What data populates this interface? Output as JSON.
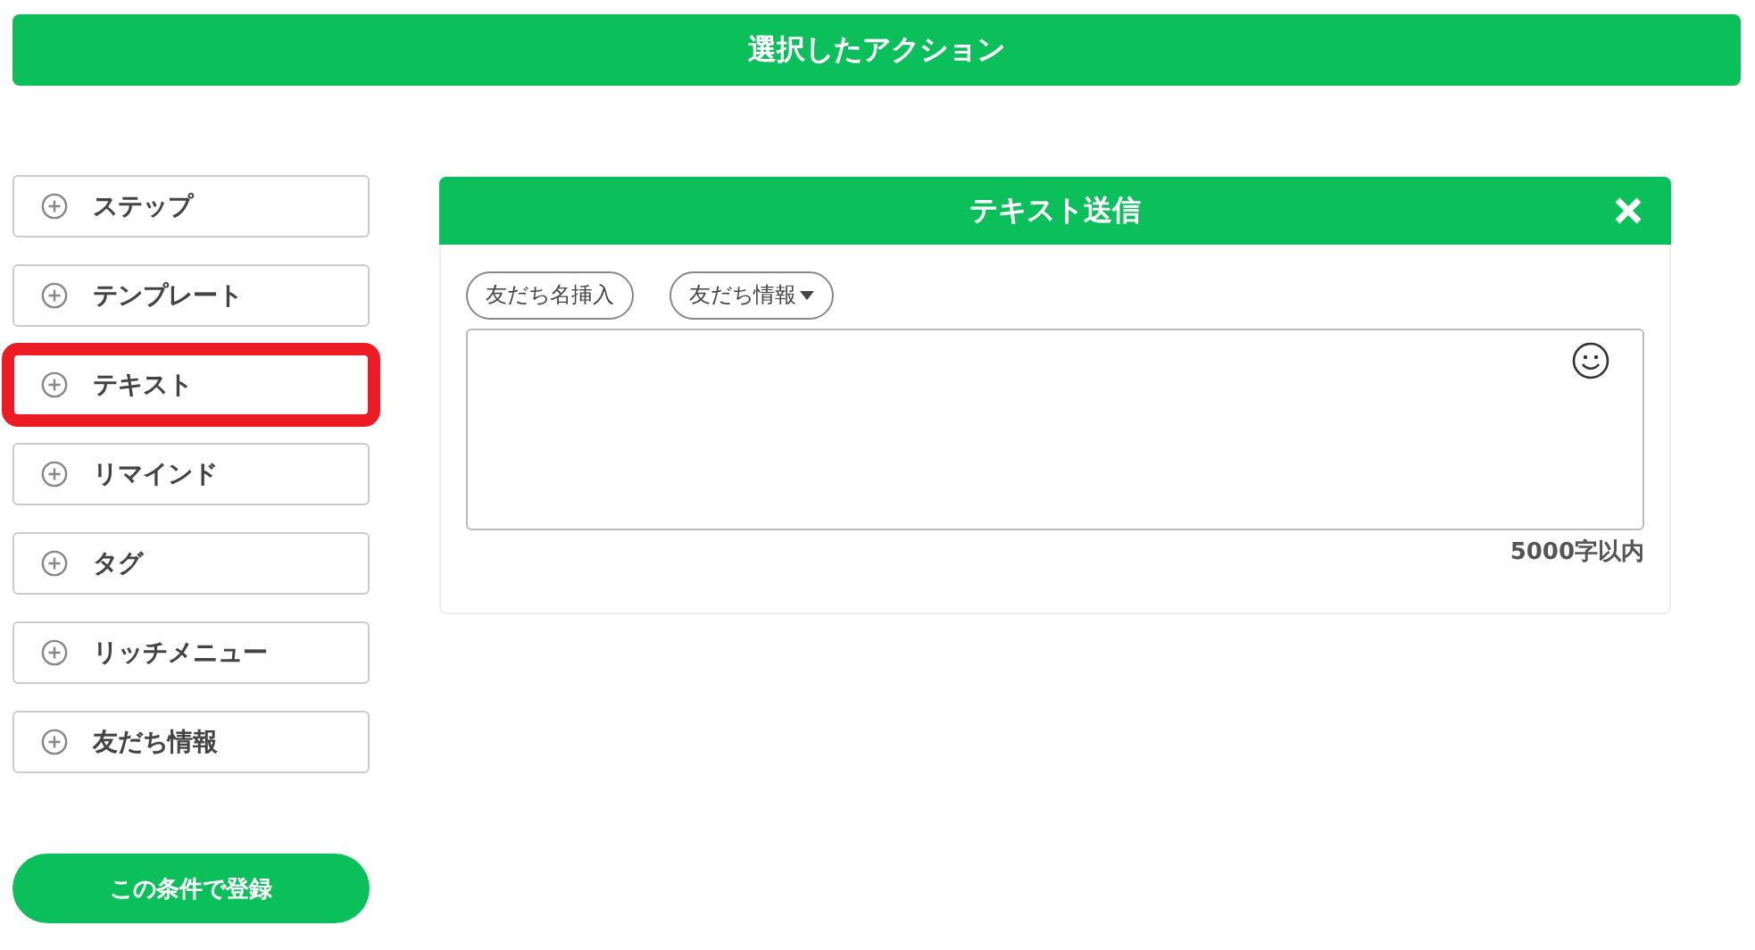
{
  "header": {
    "title": "選択したアクション"
  },
  "sidebar": {
    "items": [
      {
        "label": "ステップ",
        "highlighted": false
      },
      {
        "label": "テンプレート",
        "highlighted": false
      },
      {
        "label": "テキスト",
        "highlighted": true
      },
      {
        "label": "リマインド",
        "highlighted": false
      },
      {
        "label": "タグ",
        "highlighted": false
      },
      {
        "label": "リッチメニュー",
        "highlighted": false
      },
      {
        "label": "友だち情報",
        "highlighted": false
      }
    ]
  },
  "panel": {
    "title": "テキスト送信",
    "insert_buttons": [
      {
        "label": "友だち名挿入",
        "kind": "plain"
      },
      {
        "label": "友だち情報",
        "kind": "dropdown"
      }
    ],
    "char_limit": "5000字以内"
  },
  "submit_button": {
    "label": "この条件で登録"
  }
}
